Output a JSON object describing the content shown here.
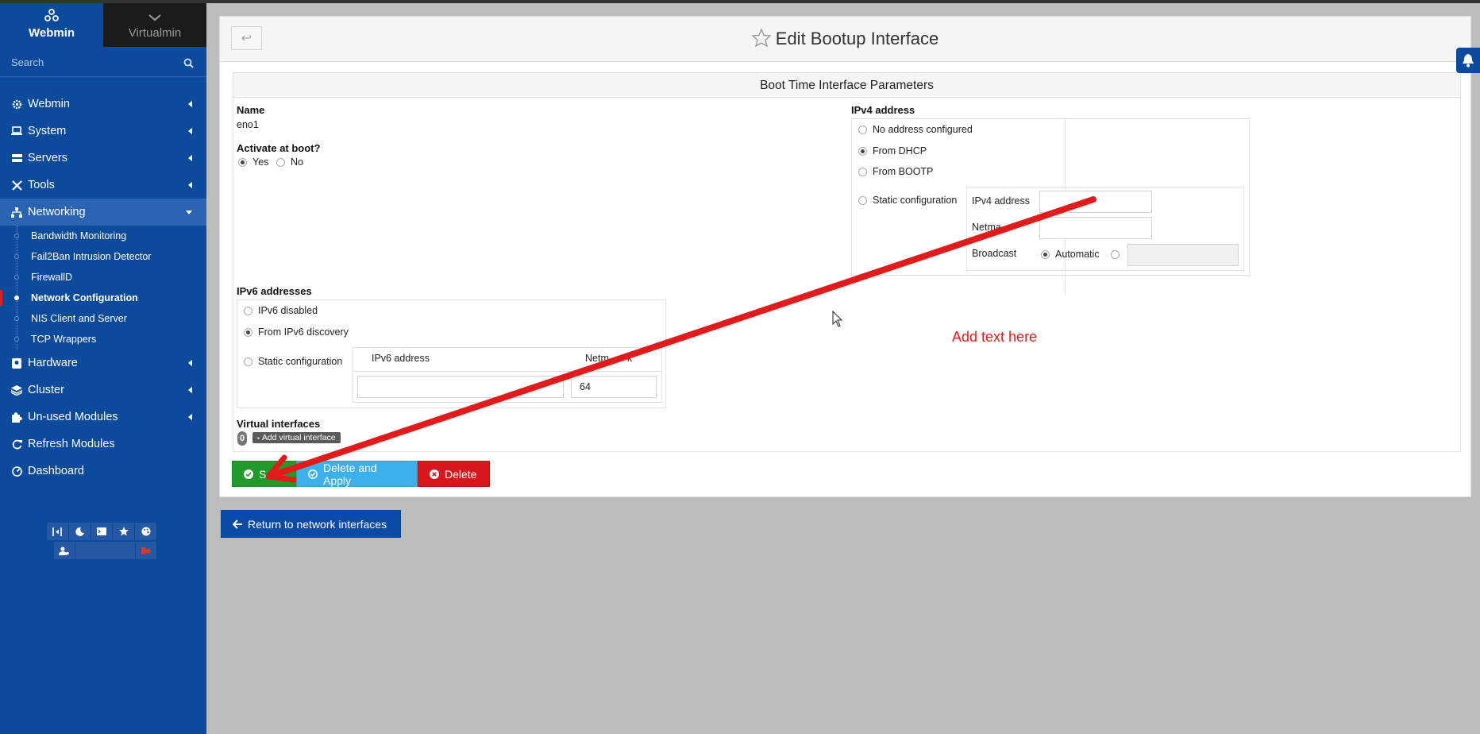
{
  "sidebar": {
    "tab_webmin": "Webmin",
    "tab_virtualmin": "Virtualmin",
    "search_placeholder": "Search",
    "menu": [
      {
        "label": "Webmin",
        "icon": "gear-icon"
      },
      {
        "label": "System",
        "icon": "laptop-icon"
      },
      {
        "label": "Servers",
        "icon": "servers-icon"
      },
      {
        "label": "Tools",
        "icon": "wrench-icon"
      },
      {
        "label": "Networking",
        "icon": "network-icon"
      }
    ],
    "networking_items": [
      "Bandwidth Monitoring",
      "Fail2Ban Intrusion Detector",
      "FirewallD",
      "Network Configuration",
      "NIS Client and Server",
      "TCP Wrappers"
    ],
    "active_item": "Network Configuration",
    "menu_after": [
      {
        "label": "Hardware",
        "icon": "hdd-icon"
      },
      {
        "label": "Cluster",
        "icon": "layers-icon"
      },
      {
        "label": "Un-used Modules",
        "icon": "puzzle-icon"
      },
      {
        "label": "Refresh Modules",
        "icon": "refresh-icon"
      },
      {
        "label": "Dashboard",
        "icon": "dashboard-icon"
      }
    ],
    "accent_color": "#0c4a9c"
  },
  "page": {
    "title": "Edit Bootup Interface",
    "back_glyph": "↩",
    "section_title": "Boot Time Interface Parameters"
  },
  "form": {
    "name_label": "Name",
    "name_value": "eno1",
    "activate_label": "Activate at boot?",
    "activate_yes": "Yes",
    "activate_no": "No",
    "activate_selected": "Yes",
    "ipv4_label": "IPv4 address",
    "ipv4_opt_none": "No address configured",
    "ipv4_opt_dhcp": "From DHCP",
    "ipv4_opt_bootp": "From BOOTP",
    "ipv4_opt_static": "Static configuration",
    "ipv4_selected": "From DHCP",
    "ipv4_field_address": "IPv4 address",
    "ipv4_field_netmask": "Netma",
    "ipv4_field_broadcast": "Broadcast",
    "broadcast_automatic": "Automatic",
    "ipv6_label": "IPv6 addresses",
    "ipv6_opt_disabled": "IPv6 disabled",
    "ipv6_opt_discovery": "From IPv6 discovery",
    "ipv6_opt_static": "Static configuration",
    "ipv6_selected": "From IPv6 discovery",
    "ipv6_col_address": "IPv6 address",
    "ipv6_col_netmask": "Netm",
    "ipv6_col_netmask_tail": "k",
    "ipv6_netmask_value": "64",
    "virtual_label": "Virtual interfaces",
    "virtual_count": "0",
    "add_virtual": "Add virtual interface"
  },
  "buttons": {
    "save": "S",
    "delete_apply": "Delete and Apply",
    "delete": "Delete",
    "return": "Return to network interfaces"
  },
  "annotation": {
    "text": "Add text here",
    "color": "#e11b1b"
  }
}
